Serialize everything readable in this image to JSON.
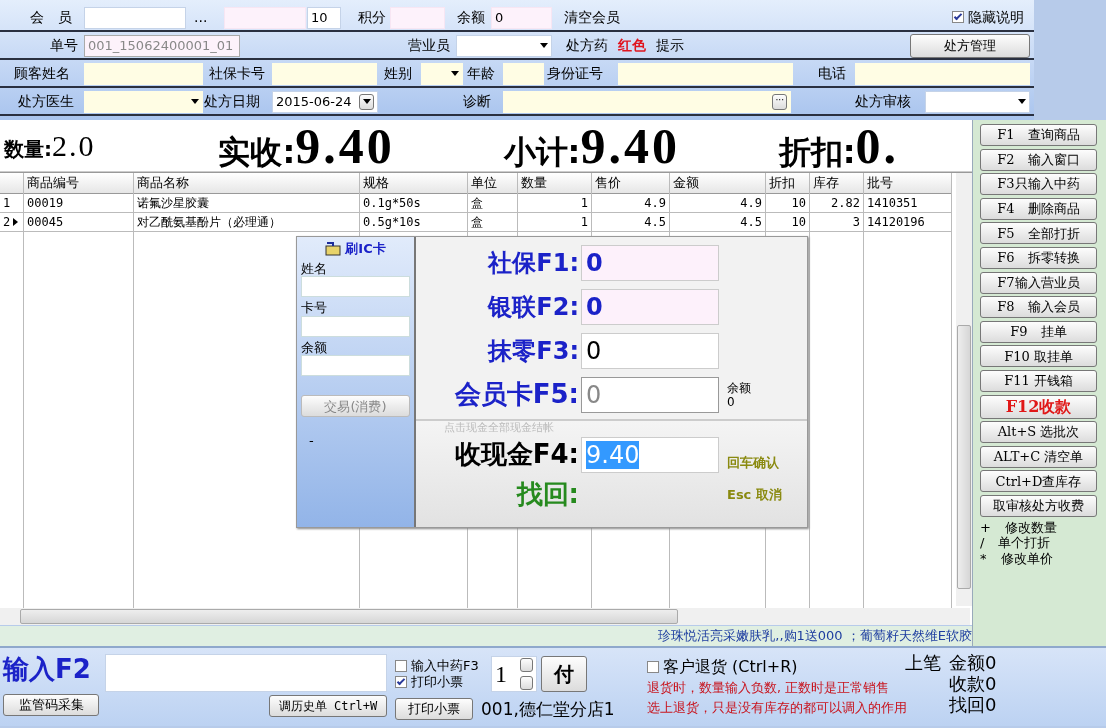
{
  "member_bar": {
    "member_label": "会　员",
    "dots": "...",
    "level_value": "10",
    "points_label": "积分",
    "balance_label": "余额",
    "balance_value": "0",
    "clear_label": "清空会员",
    "hide_notes": {
      "label": "隐藏说明",
      "checked": true
    }
  },
  "order_bar": {
    "order_label": "单号",
    "order_value": "001_15062400001_01",
    "clerk_label": "营业员",
    "rx_hint": [
      {
        "text": "处方药",
        "kind": "plain"
      },
      {
        "text": "红色",
        "kind": "red"
      },
      {
        "text": "提示",
        "kind": "plain"
      }
    ],
    "rx_manage_button": "处方管理"
  },
  "customer_bar": [
    {
      "label": "顾客姓名",
      "kind": "text"
    },
    {
      "label": "社保卡号",
      "kind": "text"
    },
    {
      "label": "姓别",
      "kind": "select"
    },
    {
      "label": "年龄",
      "kind": "text"
    },
    {
      "label": "身份证号",
      "kind": "text"
    },
    {
      "label": "电话",
      "kind": "text"
    }
  ],
  "rx_bar": {
    "doctor_label": "处方医生",
    "date_label": "处方日期",
    "date_value": "2015-06-24",
    "diagnosis_label": "诊断",
    "diagnosis_button": "···",
    "review_label": "处方审核"
  },
  "summary": [
    {
      "label": "数量:",
      "value": "2.0",
      "kind": "minor"
    },
    {
      "label": "实收:",
      "value": "9.40",
      "kind": "major"
    },
    {
      "label": "小计:",
      "value": "9.40",
      "kind": "major"
    },
    {
      "label": "折扣:",
      "value": "0.",
      "kind": "major"
    }
  ],
  "table": {
    "columns": [
      "商品编号",
      "商品名称",
      "规格",
      "单位",
      "数量",
      "售价",
      "金额",
      "折扣",
      "库存",
      "批号"
    ],
    "rows": [
      {
        "index": "1",
        "current": false,
        "cells": [
          "00019",
          "诺氟沙星胶囊",
          "0.1g*50s",
          "盒",
          "1",
          "4.9",
          "4.9",
          "10",
          "2.82",
          "1410351"
        ]
      },
      {
        "index": "2",
        "current": true,
        "cells": [
          "00045",
          "对乙酰氨基酚片（必理通）",
          "0.5g*10s",
          "盒",
          "1",
          "4.5",
          "4.5",
          "10",
          "3",
          "14120196"
        ]
      }
    ]
  },
  "payment_dialog": {
    "ic_card": {
      "title": "刷IC卡",
      "fields": [
        {
          "label": "姓名"
        },
        {
          "label": "卡号"
        },
        {
          "label": "余额"
        }
      ],
      "button": {
        "label": "交易(消费)",
        "disabled": true
      },
      "status": "-"
    },
    "payments": [
      {
        "label": "社保F1:",
        "value": "0",
        "kind": "tinted"
      },
      {
        "label": "银联F2:",
        "value": "0",
        "kind": "tinted"
      },
      {
        "label": "抹零F3:",
        "value": "0",
        "kind": "plain"
      },
      {
        "label": "会员卡F5:",
        "value": "0",
        "kind": "disabled",
        "note_label": "余额",
        "note_value": "0"
      }
    ],
    "cash_hint": "点击现金全部现金结帐",
    "cash_label": "收现金F4:",
    "cash_value": "9.40",
    "cash_selected": true,
    "confirm": "回车确认",
    "change_label": "找回:",
    "cancel": "Esc 取消"
  },
  "side_buttons": [
    {
      "label": "F1　查询商品",
      "accent": false
    },
    {
      "label": "F2　输入窗口",
      "accent": false
    },
    {
      "label": "F3只输入中药",
      "accent": false
    },
    {
      "label": "F4　删除商品",
      "accent": false
    },
    {
      "label": "F5　全部打折",
      "accent": false
    },
    {
      "label": "F6　拆零转换",
      "accent": false
    },
    {
      "label": "F7输入营业员",
      "accent": false
    },
    {
      "label": "F8　输入会员",
      "accent": false
    },
    {
      "label": "F9　挂单",
      "accent": false
    },
    {
      "label": "F10 取挂单",
      "accent": false
    },
    {
      "label": "F11 开钱箱",
      "accent": false
    },
    {
      "label": "F12收款",
      "accent": true
    },
    {
      "label": "Alt+S 选批次",
      "accent": false
    },
    {
      "label": "ALT+C 清空单",
      "accent": false
    },
    {
      "label": "Ctrl+D查库存",
      "accent": false
    },
    {
      "label": "取审核处方收费",
      "accent": false
    }
  ],
  "shortcut_notes": [
    {
      "key": "+",
      "text": "修改数量"
    },
    {
      "key": "/",
      "text": "单个打折"
    },
    {
      "key": "*",
      "text": "修改单价"
    }
  ],
  "marquee": "珍珠悦活亮采嫩肤乳,,购1送000 ；葡萄籽天然维E软胶",
  "bottom": {
    "input_label": "输入F2",
    "scan_button": "监管码采集",
    "history_button": "调历史单 Ctrl+W",
    "options": [
      {
        "label": "输入中药F3",
        "checked": false
      },
      {
        "label": "打印小票",
        "checked": true
      }
    ],
    "print_button": "打印小票",
    "quantity": "1",
    "pay_button": "付",
    "store": "001,德仁堂分店1",
    "return_option": {
      "label": "客户退货 (Ctrl+R)",
      "checked": false
    },
    "return_notes": [
      "退货时，数量输入负数, 正数时是正常销售",
      "选上退货，只是没有库存的都可以调入的作用"
    ],
    "last_label": "上笔",
    "totals": [
      {
        "label": "金额",
        "value": "0"
      },
      {
        "label": "收款",
        "value": "0"
      },
      {
        "label": "找回",
        "value": "0"
      }
    ]
  }
}
